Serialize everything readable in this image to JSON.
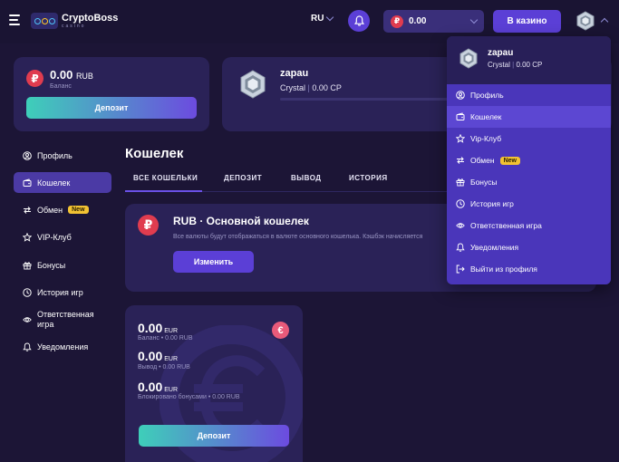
{
  "header": {
    "logo_name": "CryptoBoss",
    "logo_sub": "casino",
    "language": "RU",
    "balance": "0.00",
    "casino_button": "В казино"
  },
  "balance_card": {
    "amount": "0.00",
    "currency": "RUB",
    "label": "Баланс",
    "deposit_button": "Депозит"
  },
  "profile_card": {
    "username": "zapau",
    "level": "Crystal",
    "points": "0.00 CP"
  },
  "sidebar": {
    "items": [
      {
        "label": "Профиль",
        "icon": "user-circle-icon"
      },
      {
        "label": "Кошелек",
        "icon": "wallet-icon"
      },
      {
        "label": "Обмен",
        "icon": "exchange-icon",
        "badge": "New"
      },
      {
        "label": "VIP-Клуб",
        "icon": "star-icon"
      },
      {
        "label": "Бонусы",
        "icon": "gift-icon"
      },
      {
        "label": "История игр",
        "icon": "history-icon"
      },
      {
        "label": "Ответственная игра",
        "icon": "eye-icon"
      },
      {
        "label": "Уведомления",
        "icon": "bell-icon"
      }
    ]
  },
  "main": {
    "title": "Кошелек",
    "tabs": [
      "ВСЕ КОШЕЛЬКИ",
      "ДЕПОЗИТ",
      "ВЫВОД",
      "ИСТОРИЯ"
    ],
    "wallet": {
      "title": "RUB · Основной кошелек",
      "description": "Все валюты будут отображаться в валюте основного кошелька. Кэшбэк начисляется",
      "change_button": "Изменить"
    },
    "eur_card": {
      "balance": "0.00",
      "balance_currency": "EUR",
      "balance_label": "Баланс • 0.00 RUB",
      "withdraw": "0.00",
      "withdraw_currency": "EUR",
      "withdraw_label": "Вывод • 0.00 RUB",
      "blocked": "0.00",
      "blocked_currency": "EUR",
      "blocked_label": "Блокировано бонусами • 0.00 RUB",
      "deposit_button": "Депозит"
    }
  },
  "dropdown": {
    "username": "zapau",
    "level": "Crystal",
    "points": "0.00 CP",
    "items": [
      {
        "label": "Профиль",
        "icon": "user-circle-icon"
      },
      {
        "label": "Кошелек",
        "icon": "wallet-icon"
      },
      {
        "label": "Vip-Клуб",
        "icon": "star-icon"
      },
      {
        "label": "Обмен",
        "icon": "exchange-icon",
        "badge": "New"
      },
      {
        "label": "Бонусы",
        "icon": "gift-icon"
      },
      {
        "label": "История игр",
        "icon": "history-icon"
      },
      {
        "label": "Ответственная игра",
        "icon": "eye-icon"
      },
      {
        "label": "Уведомления",
        "icon": "bell-icon"
      },
      {
        "label": "Выйти из профиля",
        "icon": "logout-icon"
      }
    ]
  },
  "colors": {
    "background": "#1c1536",
    "card": "#2a2257",
    "accent": "#5b3fd6",
    "teal": "#3ecfb9",
    "ruble": "#e03c4f",
    "badge": "#f2c233"
  }
}
